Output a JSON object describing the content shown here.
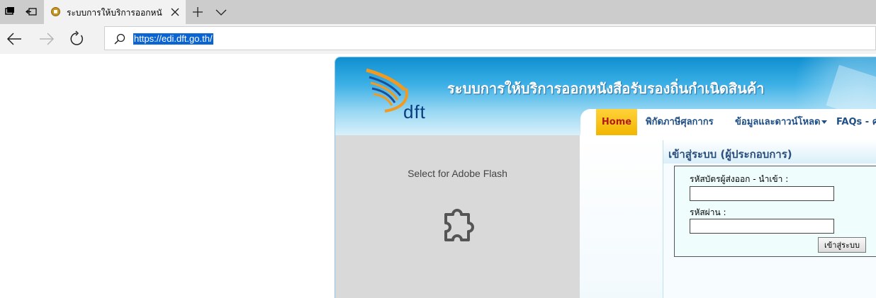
{
  "browser": {
    "tab": {
      "title": "ระบบการให้บริการออกหนังสื"
    },
    "address": {
      "url": "https://edi.dft.go.th/"
    }
  },
  "site": {
    "logo_text": "dft",
    "title": "ระบบการให้บริการออกหนังสือรับรองถิ่นกำเนิดสินค้า",
    "menu": {
      "home": "Home",
      "tariff": "พิกัดภาษีศุลกากร",
      "downloads": "ข้อมูลและดาวน์โหลด",
      "faqs": "FAQs - คำ"
    },
    "flash": {
      "placeholder": "Select for Adobe Flash"
    },
    "login": {
      "title": "เข้าสู่ระบบ (ผู้ประกอบการ)",
      "id_label": "รหัสบัตรผู้ส่งออก - นำเข้า :",
      "password_label": "รหัสผ่าน :",
      "submit": "เข้าสู่ระบบ"
    }
  },
  "colors": {
    "banner": "#3cb0e6",
    "menu_home_bg": "#f2b600",
    "menu_text": "#1f4f86",
    "url_highlight": "#0a64d2"
  }
}
